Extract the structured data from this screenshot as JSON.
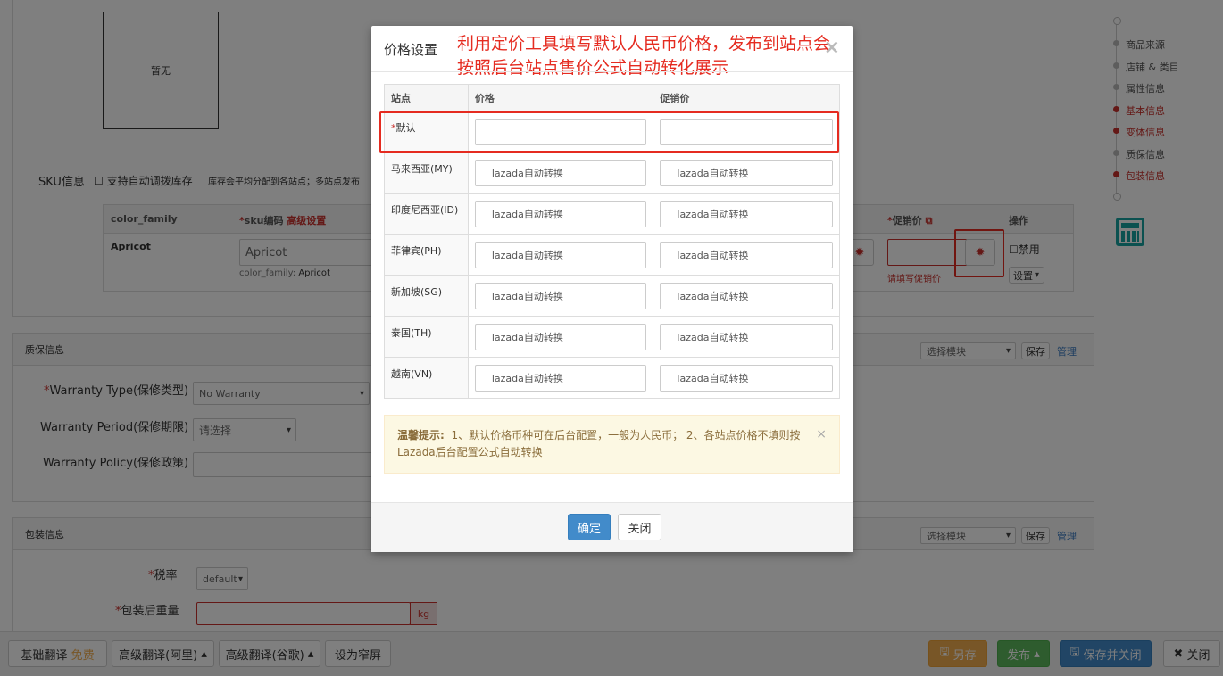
{
  "colors": {
    "accent_red": "#e52b20",
    "primary_blue": "#428bca",
    "success_green": "#5cb85c",
    "warning_orange": "#f0ad4e"
  },
  "image": {
    "placeholder": "暂无"
  },
  "sku": {
    "label": "SKU信息",
    "auto_allocate": "支持自动调拨库存",
    "note": "库存会平均分配到各站点；多站点发布",
    "headers": {
      "color_family": "color_family",
      "sku_code": "sku编码",
      "advanced": "高级设置",
      "promo_price": "促销价",
      "action": "操作"
    },
    "row": {
      "color": "Apricot",
      "sku_input": "Apricot",
      "color_family_prefix": "color_family:",
      "color_family_value": "Apricot",
      "promo_error": "请填写促销价",
      "disable": "禁用",
      "settings": "设置"
    }
  },
  "warranty": {
    "title": "质保信息",
    "module_select": "选择模块",
    "save": "保存",
    "manage": "管理",
    "type_label": "Warranty Type(保修类型)",
    "type_value": "No Warranty",
    "period_label": "Warranty Period(保修期限)",
    "period_value": "请选择",
    "policy_label": "Warranty Policy(保修政策)"
  },
  "package": {
    "title": "包装信息",
    "module_select": "选择模块",
    "save": "保存",
    "manage": "管理",
    "tax_label": "税率",
    "tax_value": "default",
    "weight_label": "包装后重量",
    "weight_unit": "kg"
  },
  "side_nav": {
    "items": [
      {
        "label": "商品来源",
        "active": false
      },
      {
        "label": "店铺 & 类目",
        "active": false
      },
      {
        "label": "属性信息",
        "active": false
      },
      {
        "label": "基本信息",
        "active": true
      },
      {
        "label": "变体信息",
        "active": true
      },
      {
        "label": "质保信息",
        "active": false
      },
      {
        "label": "包装信息",
        "active": true
      }
    ]
  },
  "bottom_bar": {
    "basic_translate": "基础翻译",
    "free": "免费",
    "adv_translate_ali": "高级翻译(阿里)",
    "adv_translate_google": "高级翻译(谷歌)",
    "set_narrow": "设为窄屏",
    "save_as": "另存",
    "publish": "发布",
    "save_close": "保存并关闭",
    "close": "关闭"
  },
  "modal": {
    "title": "价格设置",
    "annotation": "利用定价工具填写默认人民币价格，发布到站点会按照后台站点售价公式自动转化展示",
    "columns": [
      "站点",
      "价格",
      "促销价"
    ],
    "rows": [
      {
        "site": "默认",
        "required": true,
        "price": "",
        "promo": ""
      },
      {
        "site": "马来西亚(MY)",
        "price": "lazada自动转换",
        "promo": "lazada自动转换"
      },
      {
        "site": "印度尼西亚(ID)",
        "price": "lazada自动转换",
        "promo": "lazada自动转换"
      },
      {
        "site": "菲律宾(PH)",
        "price": "lazada自动转换",
        "promo": "lazada自动转换"
      },
      {
        "site": "新加坡(SG)",
        "price": "lazada自动转换",
        "promo": "lazada自动转换"
      },
      {
        "site": "泰国(TH)",
        "price": "lazada自动转换",
        "promo": "lazada自动转换"
      },
      {
        "site": "越南(VN)",
        "price": "lazada自动转换",
        "promo": "lazada自动转换"
      }
    ],
    "tip_title": "温馨提示:",
    "tip_text": "1、默认价格币种可在后台配置，一般为人民币； 2、各站点价格不填则按Lazada后台配置公式自动转换",
    "confirm": "确定",
    "close": "关闭"
  }
}
